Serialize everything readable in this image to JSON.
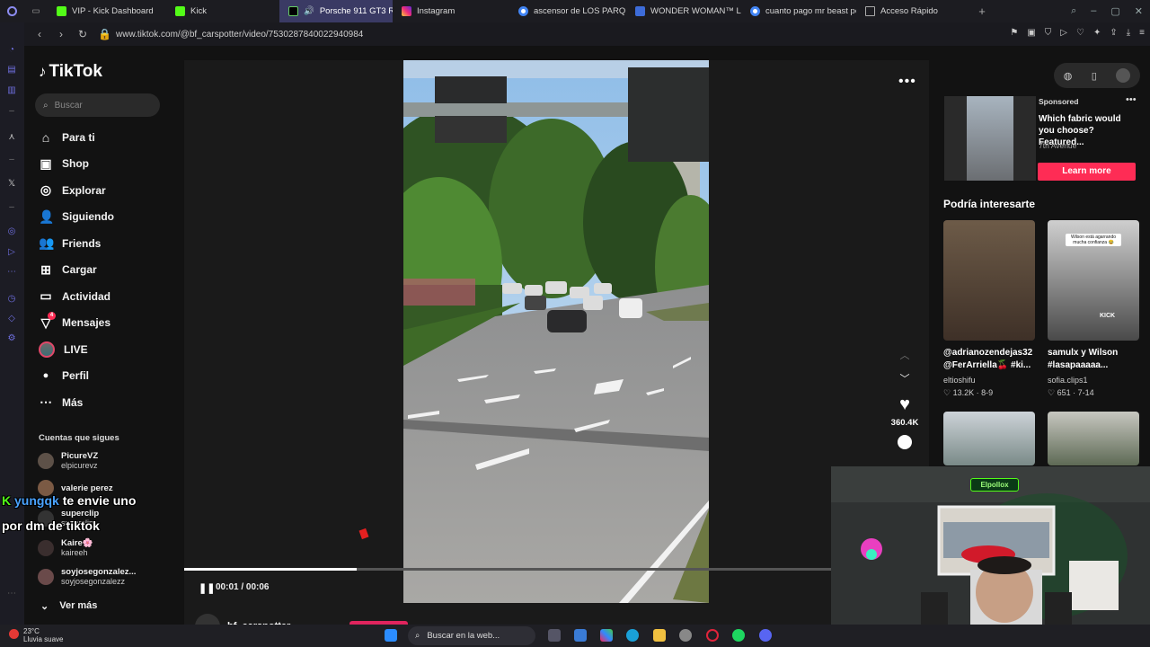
{
  "tabs": [
    {
      "label": "VIP - Kick Dashboard",
      "icon": "kick-icon",
      "active": false
    },
    {
      "label": "Kick",
      "icon": "kick-icon",
      "active": false
    },
    {
      "label": "Porsche 911 GT3 RS:",
      "icon": "tiktok-icon",
      "active": true
    },
    {
      "label": "Instagram",
      "icon": "instagram-icon",
      "active": false
    },
    {
      "label": "ascensor de LOS PARQU",
      "icon": "google-icon",
      "active": false
    },
    {
      "label": "WONDER WOMAN™ Lass",
      "icon": "webpage-icon",
      "active": false
    },
    {
      "label": "cuanto pago mr beast po",
      "icon": "google-icon",
      "active": false
    },
    {
      "label": "Acceso Rápido",
      "icon": "grid-icon",
      "active": false
    }
  ],
  "address": {
    "url": "www.tiktok.com/@bf_carspotter/video/7530287840022940984"
  },
  "tiktok": {
    "logo": "TikTok",
    "search_placeholder": "Buscar",
    "menu": [
      {
        "label": "Para ti",
        "icon": "home-icon"
      },
      {
        "label": "Shop",
        "icon": "shop-bag-icon"
      },
      {
        "label": "Explorar",
        "icon": "compass-icon"
      },
      {
        "label": "Siguiendo",
        "icon": "following-icon"
      },
      {
        "label": "Friends",
        "icon": "friends-icon"
      },
      {
        "label": "Cargar",
        "icon": "upload-icon"
      },
      {
        "label": "Actividad",
        "icon": "activity-icon"
      },
      {
        "label": "Mensajes",
        "icon": "messages-icon",
        "badge": "4"
      },
      {
        "label": "LIVE",
        "icon": "live-icon"
      },
      {
        "label": "Perfil",
        "icon": "profile-icon"
      },
      {
        "label": "Más",
        "icon": "more-icon"
      }
    ],
    "following_heading": "Cuentas que sigues",
    "following": [
      {
        "name": "PicureVZ",
        "handle": "elpicurevz"
      },
      {
        "name": "valerie perez",
        "handle": ""
      },
      {
        "name": "superclip",
        "handle": "superclip"
      },
      {
        "name": "Kaire🌸",
        "handle": "kaireeh"
      },
      {
        "name": "soyjosegonzalez...",
        "handle": "soyjosegonzalezz"
      }
    ],
    "see_more": "Ver más",
    "player": {
      "time": "00:01 / 00:06",
      "progress": 0.167
    },
    "actions": {
      "likes": "360.4K"
    },
    "author": "bf_carspotter"
  },
  "right": {
    "sponsored_label": "Sponsored",
    "ad_title": "Which fabric would you choose? Featured...",
    "ad_advertiser": "7th Avenue",
    "ad_button": "Learn more",
    "section_title": "Podría interesarte",
    "recs": [
      {
        "caption": "@adrianozendejas32 @FerArriella🍒 #ki...",
        "author": "eltioshifu",
        "likes": "13.2K",
        "date": "8-9"
      },
      {
        "caption": "samulx y Wilson #lasapaaaaa...",
        "author": "sofia.clips1",
        "likes": "651",
        "date": "7-14",
        "thumb_text": "Wilson está agarrando mucha confianza 😂",
        "thumb_tag": "KICK"
      }
    ]
  },
  "overlay": {
    "chat_user": "yungqk",
    "chat_line1": "te envie uno",
    "chat_line2": "por dm de tiktok",
    "cam_sign": "Elpollox"
  },
  "taskbar": {
    "temperature": "23°C",
    "weather": "Lluvia suave",
    "search_placeholder": "Buscar en la web..."
  }
}
